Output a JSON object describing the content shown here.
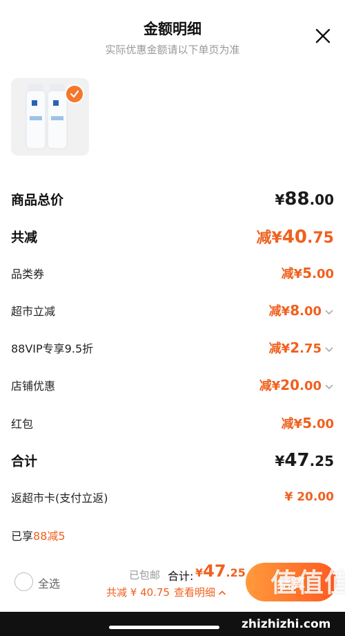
{
  "header": {
    "title": "金额明细",
    "subtitle": "实际优惠金额请以下单页为准"
  },
  "rows": {
    "goods_total": {
      "label": "商品总价",
      "currency": "¥",
      "int": "88",
      "dec": ".00"
    },
    "total_reduction": {
      "label": "共减",
      "prefix": "减",
      "currency": "¥",
      "int": "40",
      "dec": ".75"
    },
    "category_coupon": {
      "label": "品类券",
      "prefix": "减",
      "currency": "¥",
      "int": "5",
      "dec": ".00"
    },
    "supermarket_discount": {
      "label": "超市立减",
      "prefix": "减",
      "currency": "¥",
      "int": "8",
      "dec": ".00"
    },
    "vip_discount": {
      "label": "88VIP专享9.5折",
      "prefix": "减",
      "currency": "¥",
      "int": "2",
      "dec": ".75"
    },
    "store_offer": {
      "label": "店铺优惠",
      "prefix": "减",
      "currency": "¥",
      "int": "20",
      "dec": ".00"
    },
    "red_packet": {
      "label": "红包",
      "prefix": "减",
      "currency": "¥",
      "int": "5",
      "dec": ".00"
    },
    "subtotal": {
      "label": "合计",
      "currency": "¥",
      "int": "47",
      "dec": ".25"
    },
    "cashback": {
      "label": "返超市卡(支付立返)",
      "value": "¥ 20.00"
    }
  },
  "vip_note": {
    "prefix": "已享",
    "highlight": "88减5"
  },
  "bottom_bar": {
    "select_all": "全选",
    "shipping": "已包邮",
    "total_label": "合计:",
    "total_currency": "¥",
    "total_int": "47",
    "total_dec": ".25",
    "saved": "共减 ¥ 40.75",
    "view_detail": "查看明细",
    "checkout": "结算"
  },
  "watermark": {
    "logo": "值值值",
    "domain": "zhizhizhi.com"
  },
  "colors": {
    "accent": "#f0601e",
    "checkout_start": "#ff9a3c",
    "checkout_end": "#ff5a1f"
  }
}
